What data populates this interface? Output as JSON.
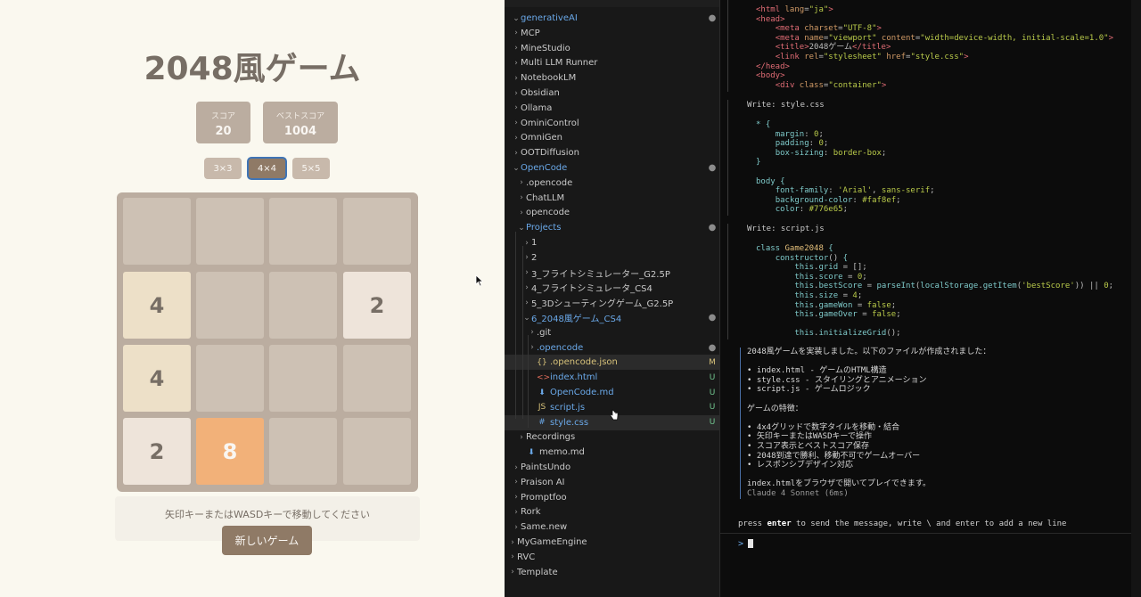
{
  "game": {
    "title": "2048風ゲーム",
    "score_label": "スコア",
    "score_value": "20",
    "best_label": "ベストスコア",
    "best_value": "1004",
    "size_options": [
      "3×3",
      "4×4",
      "5×5"
    ],
    "selected_size": "4×4",
    "board": [
      [
        "",
        "",
        "",
        ""
      ],
      [
        "4",
        "",
        "",
        "2"
      ],
      [
        "4",
        "",
        "",
        ""
      ],
      [
        "2",
        "8",
        "",
        ""
      ]
    ],
    "help_text": "矢印キーまたはWASDキーで移動してください",
    "new_game_label": "新しいゲーム"
  },
  "explorer": {
    "items": [
      {
        "label": "generativeAI",
        "depth": 0,
        "chev": "⌄",
        "badge": "●",
        "color": "blue"
      },
      {
        "label": "MCP",
        "depth": 0,
        "chev": "›",
        "badge": ""
      },
      {
        "label": "MineStudio",
        "depth": 0,
        "chev": "›",
        "badge": ""
      },
      {
        "label": "Multi LLM Runner",
        "depth": 0,
        "chev": "›",
        "badge": ""
      },
      {
        "label": "NotebookLM",
        "depth": 0,
        "chev": "›",
        "badge": ""
      },
      {
        "label": "Obsidian",
        "depth": 0,
        "chev": "›",
        "badge": ""
      },
      {
        "label": "Ollama",
        "depth": 0,
        "chev": "›",
        "badge": ""
      },
      {
        "label": "OminiControl",
        "depth": 0,
        "chev": "›",
        "badge": ""
      },
      {
        "label": "OmniGen",
        "depth": 0,
        "chev": "›",
        "badge": ""
      },
      {
        "label": "OOTDiffusion",
        "depth": 0,
        "chev": "›",
        "badge": ""
      },
      {
        "label": "OpenCode",
        "depth": 0,
        "chev": "⌄",
        "badge": "●",
        "color": "blue"
      },
      {
        "label": ".opencode",
        "depth": 1,
        "chev": "›",
        "badge": ""
      },
      {
        "label": "ChatLLM",
        "depth": 1,
        "chev": "›",
        "badge": ""
      },
      {
        "label": "opencode",
        "depth": 1,
        "chev": "›",
        "badge": ""
      },
      {
        "label": "Projects",
        "depth": 1,
        "chev": "⌄",
        "badge": "●",
        "color": "blue"
      },
      {
        "label": "1",
        "depth": 2,
        "chev": "›",
        "badge": ""
      },
      {
        "label": "2",
        "depth": 2,
        "chev": "›",
        "badge": ""
      },
      {
        "label": "3_フライトシミュレーター_G2.5P",
        "depth": 2,
        "chev": "›",
        "badge": ""
      },
      {
        "label": "4_フライトシミュレータ_CS4",
        "depth": 2,
        "chev": "›",
        "badge": ""
      },
      {
        "label": "5_3Dシューティングゲーム_G2.5P",
        "depth": 2,
        "chev": "›",
        "badge": ""
      },
      {
        "label": "6_2048風ゲーム_CS4",
        "depth": 2,
        "chev": "⌄",
        "badge": "●",
        "color": "blue"
      },
      {
        "label": ".git",
        "depth": 3,
        "chev": "›",
        "badge": ""
      },
      {
        "label": ".opencode",
        "depth": 3,
        "chev": "›",
        "badge": "●",
        "color": "blue"
      },
      {
        "label": ".opencode.json",
        "depth": 3,
        "chev": "",
        "icon": "{}",
        "icon_color": "#d7c27a",
        "badge": "M",
        "color": "yellow",
        "hl": true
      },
      {
        "label": "index.html",
        "depth": 3,
        "chev": "",
        "icon": "<>",
        "icon_color": "#e06c5a",
        "badge": "U",
        "color": "blue"
      },
      {
        "label": "OpenCode.md",
        "depth": 3,
        "chev": "",
        "icon": "⬇",
        "icon_color": "#6aa8e8",
        "badge": "U",
        "color": "blue"
      },
      {
        "label": "script.js",
        "depth": 3,
        "chev": "",
        "icon": "JS",
        "icon_color": "#d7c27a",
        "badge": "U",
        "color": "blue"
      },
      {
        "label": "style.css",
        "depth": 3,
        "chev": "",
        "icon": "#",
        "icon_color": "#6aa8e8",
        "badge": "U",
        "color": "blue",
        "hl": true
      },
      {
        "label": "Recordings",
        "depth": 1,
        "chev": "›",
        "badge": ""
      },
      {
        "label": "memo.md",
        "depth": 1,
        "chev": "",
        "icon": "⬇",
        "icon_color": "#6aa8e8",
        "badge": ""
      },
      {
        "label": "PaintsUndo",
        "depth": 0,
        "chev": "›",
        "badge": ""
      },
      {
        "label": "Praison AI",
        "depth": 0,
        "chev": "›",
        "badge": ""
      },
      {
        "label": "Promptfoo",
        "depth": 0,
        "chev": "›",
        "badge": ""
      },
      {
        "label": "Rork",
        "depth": 0,
        "chev": "›",
        "badge": ""
      },
      {
        "label": "Same.new",
        "depth": 0,
        "chev": "›",
        "badge": ""
      },
      {
        "label": "MyGameEngine",
        "depth": -1,
        "chev": "›",
        "badge": ""
      },
      {
        "label": "RVC",
        "depth": -1,
        "chev": "›",
        "badge": ""
      },
      {
        "label": "Template",
        "depth": -1,
        "chev": "›",
        "badge": ""
      }
    ]
  },
  "terminal": {
    "write_css_title": "Write: style.css",
    "write_js_title": "Write: script.js",
    "summary_lines": [
      "2048風ゲームを実装しました。以下のファイルが作成されました：",
      "",
      "• index.html - ゲームのHTML構造",
      "• style.css - スタイリングとアニメーション",
      "• script.js - ゲームロジック",
      "",
      "ゲームの特徴：",
      "",
      "• 4x4グリッドで数字タイルを移動・結合",
      "• 矢印キーまたはWASDキーで操作",
      "• スコア表示とベストスコア保存",
      "• 2048到達で勝利、移動不可でゲームオーバー",
      "• レスポンシブデザイン対応",
      "",
      "index.htmlをブラウザで開いてプレイできます。",
      "Claude 4 Sonnet (6ms)"
    ],
    "hint_pre": "press",
    "hint_key": "enter",
    "hint_post": "to send the message, write \\ and enter to add a new line",
    "prompt": ">"
  }
}
